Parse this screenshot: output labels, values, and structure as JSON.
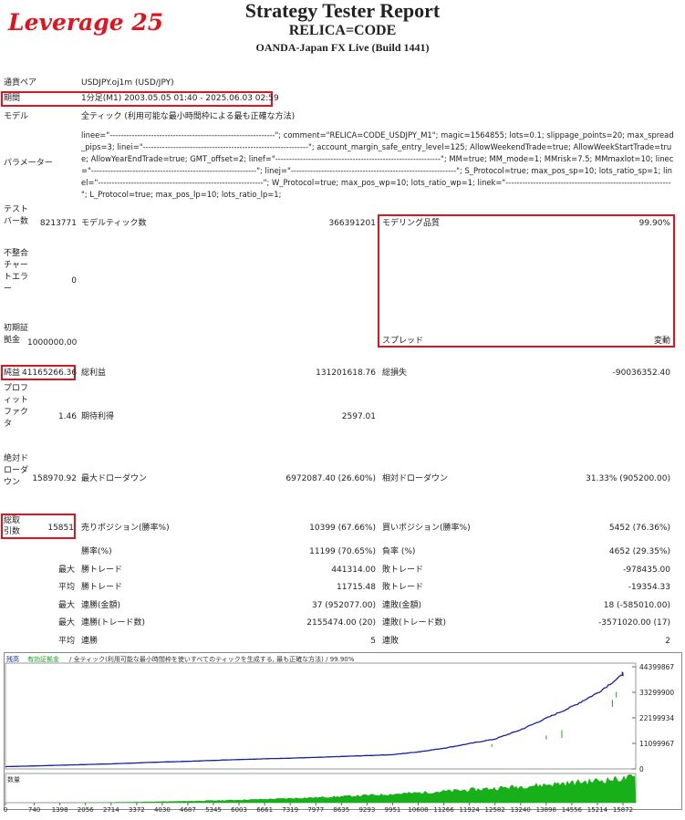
{
  "overlay": {
    "leverage_label": "Leverage 25"
  },
  "header": {
    "title": "Strategy Tester Report",
    "subtitle": "RELICA=CODE",
    "broker": "OANDA-Japan FX Live (Build 1441)"
  },
  "info": {
    "pair_label": "通貨ペア",
    "pair_value": "USDJPY.oj1m (USD/JPY)",
    "period_label": "期間",
    "period_value": "1分足(M1) 2003.05.05 01:40 - 2025.06.03 02:59",
    "model_label": "モデル",
    "model_value": "全ティック (利用可能な最小時間枠による最も正確な方法)",
    "param_label": "パラメーター",
    "param_value": "linee=\"------------------------------------------------------------\"; comment=\"RELICA=CODE_USDJPY_M1\"; magic=1564855; lots=0.1; slippage_points=20; max_spread_pips=3; linei=\"------------------------------------------------------------\"; account_margin_safe_entry_level=125; AllowWeekendTrade=true; AllowWeekStartTrade=true; AllowYearEndTrade=true; GMT_offset=2; linef=\"------------------------------------------------------------\"; MM=true; MM_mode=1; MMrisk=7.5; MMmaxlot=10; linec=\"------------------------------------------------------------\"; linej=\"------------------------------------------------------------\"; S_Protocol=true; max_pos_sp=10; lots_ratio_sp=1; linel=\"------------------------------------------------------------\"; W_Protocol=true; max_pos_wp=10; lots_ratio_wp=1; linek=\"------------------------------------------------------------\"; L_Protocol=true; max_pos_lp=10; lots_ratio_lp=1;"
  },
  "stats": {
    "test_bars_label": "テストバー数",
    "test_bars_value": "8213771",
    "model_ticks_label": "モデルティック数",
    "model_ticks_value": "366391201",
    "model_quality_label": "モデリング品質",
    "model_quality_value": "99.90%",
    "mismatch_label": "不整合チャートエラー",
    "mismatch_value": "0",
    "deposit_label": "初期証拠金",
    "deposit_value": "1000000.00",
    "spread_label": "スプレッド",
    "spread_value": "変動",
    "net_label": "純益",
    "net_value": "41165266.36",
    "gross_profit_label": "総利益",
    "gross_profit_value": "131201618.76",
    "gross_loss_label": "総損失",
    "gross_loss_value": "-90036352.40",
    "pf_label": "プロフィットファクタ",
    "pf_value": "1.46",
    "expected_label": "期待利得",
    "expected_value": "2597.01",
    "abs_dd_label": "絶対ドローダウン",
    "abs_dd_value": "158970.92",
    "max_dd_label": "最大ドローダウン",
    "max_dd_value": "6972087.40 (26.60%)",
    "rel_dd_label": "相対ドローダウン",
    "rel_dd_value": "31.33% (905200.00)",
    "total_trades_label": "総取引数",
    "total_trades_value": "15851",
    "short_label": "売りポジション(勝率%)",
    "short_value": "10399 (67.66%)",
    "long_label": "買いポジション(勝率%)",
    "long_value": "5452 (76.36%)",
    "win_label": "勝率(%)",
    "win_value": "11199 (70.65%)",
    "loss_label": "負率 (%)",
    "loss_value": "4652 (29.35%)",
    "rows": [
      {
        "prefix": "最大",
        "l1": "勝トレード",
        "v1": "441314.00",
        "l2": "敗トレード",
        "v2": "-978435.00"
      },
      {
        "prefix": "平均",
        "l1": "勝トレード",
        "v1": "11715.48",
        "l2": "敗トレード",
        "v2": "-19354.33"
      },
      {
        "prefix": "最大",
        "l1": "連勝(金額)",
        "v1": "37 (952077.00)",
        "l2": "連敗(金額)",
        "v2": "18 (-585010.00)"
      },
      {
        "prefix": "最大",
        "l1": "連勝(トレード数)",
        "v1": "2155474.00 (20)",
        "l2": "連敗(トレード数)",
        "v2": "-3571020.00 (17)"
      },
      {
        "prefix": "平均",
        "l1": "連勝",
        "v1": "5",
        "l2": "連敗",
        "v2": "2"
      }
    ]
  },
  "chart_data": {
    "type": "line",
    "legend_balance": "残高",
    "legend_equity": "有効証拠金",
    "legend_rest": "/ 全ティック(利用可能な最小時間枠を使いすべてのティックを生成する, 最も正確な方法) / 99.90%",
    "volume_label": "数量",
    "y_ticks": [
      "44399867",
      "33299900",
      "22199934",
      "11099967",
      "0"
    ],
    "x_ticks": [
      "0",
      "740",
      "1398",
      "2056",
      "2714",
      "3372",
      "4030",
      "4687",
      "5345",
      "6003",
      "6661",
      "7319",
      "7977",
      "8635",
      "9293",
      "9951",
      "10608",
      "11266",
      "11924",
      "12582",
      "13240",
      "13898",
      "14556",
      "15214",
      "15872"
    ],
    "ylim": [
      0,
      44399867
    ],
    "x": [
      0,
      740,
      1398,
      2056,
      2714,
      3372,
      4030,
      4687,
      5345,
      6003,
      6661,
      7319,
      7977,
      8635,
      9293,
      9951,
      10608,
      11266,
      11924,
      12582,
      13240,
      13898,
      14556,
      15214,
      15872,
      15851
    ],
    "balance": [
      1000000,
      1300000,
      1600000,
      1900000,
      2200000,
      2600000,
      3000000,
      3300000,
      3700000,
      4100000,
      4400000,
      4700000,
      5000000,
      5400000,
      5800000,
      6200000,
      7400000,
      9000000,
      11000000,
      13000000,
      17000000,
      22000000,
      27000000,
      33000000,
      41000000,
      42165266
    ],
    "colors": {
      "balance": "#1420a0",
      "equity": "#18a418",
      "volume": "#18b018"
    }
  }
}
